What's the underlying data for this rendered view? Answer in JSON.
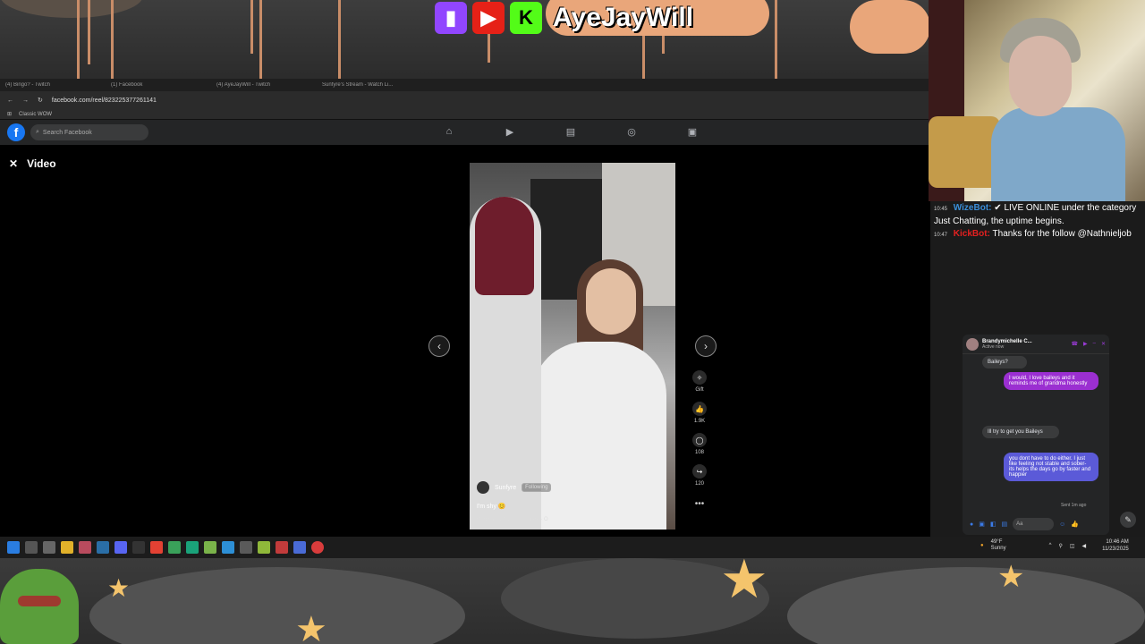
{
  "overlay": {
    "channel_name": "AyeJayWill",
    "platform_icons": [
      "twitch-icon",
      "youtube-icon",
      "kick-icon"
    ],
    "accent_colors": {
      "twitch": "#9146ff",
      "youtube": "#e62117",
      "kick": "#53fc18"
    }
  },
  "browser": {
    "tabs": [
      "(4) Bingo? - Twitch",
      "(1) Facebook",
      "(4) AyeJayWill - Twitch",
      "Sunfyre's Stream - Watch Li..."
    ],
    "url": "facebook.com/reel/823225377261141",
    "bookmarks": [
      "Classic WOW"
    ]
  },
  "facebook": {
    "search_placeholder": "Search Facebook",
    "page_title": "Video",
    "nav_icons": [
      "home-icon",
      "video-icon",
      "marketplace-icon",
      "groups-icon",
      "gaming-icon"
    ]
  },
  "reel": {
    "author": "Sunfyre",
    "follow_label": "Following",
    "caption": "I'm shy 😊",
    "audio": "Original audio",
    "audio_author": "Sunfyre · O",
    "actions": {
      "gift_label": "Gift",
      "likes": "1.9K",
      "comments": "108",
      "shares": "120"
    }
  },
  "chat": [
    {
      "time": "10:45",
      "user": "WizeBot:",
      "message": "LIVE ONLINE under the category Just Chatting, the uptime begins."
    },
    {
      "time": "10:47",
      "user": "KickBot:",
      "message": "Thanks for the follow @Nathnieljob"
    }
  ],
  "messenger": {
    "contact": "Brandymichelle C...",
    "status": "Active now",
    "messages": [
      {
        "from": "them",
        "text": "Baileys?"
      },
      {
        "from": "me",
        "text": "I would, I love baileys and it reminds me of grandma honestly"
      },
      {
        "from": "them",
        "text": "Ill try to get you Baileys"
      },
      {
        "from": "me",
        "text": "you dont have to do either. I just like feeling not stable and sober- its helps the days go by faster and happier"
      }
    ],
    "sent_status": "Sent 1m ago",
    "input_placeholder": "Aa"
  },
  "taskbar": {
    "weather_temp": "49°F",
    "weather_desc": "Sunny",
    "time": "10:46 AM",
    "date": "11/23/2025"
  }
}
